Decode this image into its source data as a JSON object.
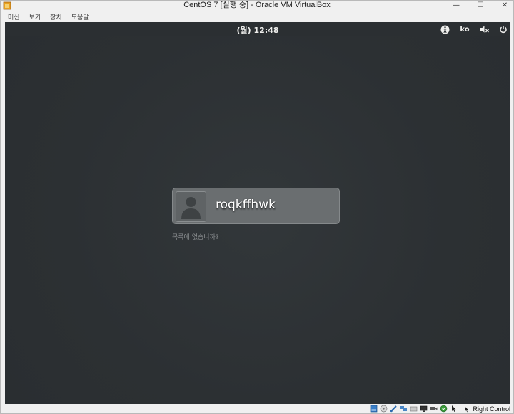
{
  "window": {
    "title": "CentOS 7 [실행 중] - Oracle VM VirtualBox",
    "controls": {
      "minimize": "—",
      "maximize": "☐",
      "close": "✕"
    }
  },
  "menubar": {
    "items": [
      "머신",
      "보기",
      "장치",
      "도움말"
    ]
  },
  "gnome": {
    "clock": "(월) 12:48",
    "language": "ko",
    "icons": [
      "accessibility-icon",
      "volume-muted-icon",
      "power-icon"
    ]
  },
  "login": {
    "username": "roqkffhwk",
    "not_listed": "목록에 없습니까?"
  },
  "statusbar": {
    "host_key": "Right Control",
    "icons": [
      "hard-disk-icon",
      "optical-drive-icon",
      "usb-icon",
      "network-icon",
      "shared-folders-icon",
      "display-icon",
      "video-capture-icon",
      "cpu-icon",
      "mouse-integration-icon",
      "host-key-icon"
    ]
  },
  "colors": {
    "vm_background": "#2d3134",
    "user_box": "#6a6e70",
    "topbar_text": "#eeeeec"
  }
}
